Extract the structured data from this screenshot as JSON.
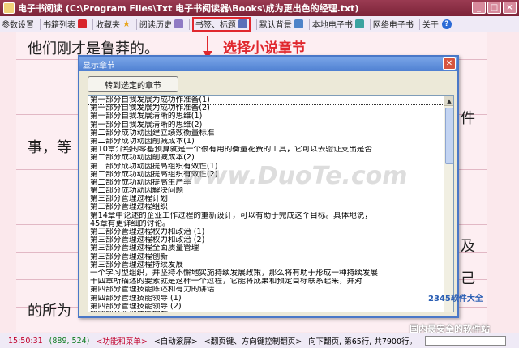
{
  "window": {
    "title": "电子书阅读 (C:\\Program Files\\Txt 电子书阅读器\\Books\\成为更出色的经理.txt)"
  },
  "toolbar": {
    "items": [
      {
        "label": "参数设置",
        "icon": "settings-icon"
      },
      {
        "label": "书籍列表",
        "icon": "book-list-icon"
      },
      {
        "label": "收藏夹",
        "icon": "favorites-star-icon"
      },
      {
        "label": "阅读历史",
        "icon": "history-icon"
      },
      {
        "label": "书签、标题",
        "icon": "bookmark-icon"
      },
      {
        "label": "默认背景",
        "icon": "background-icon"
      },
      {
        "label": "本地电子书",
        "icon": "local-ebook-icon"
      },
      {
        "label": "网络电子书",
        "icon": "network-ebook-icon"
      },
      {
        "label": "关于",
        "icon": "help-icon"
      }
    ],
    "help_glyph": "?"
  },
  "annotation": "选择小说章节",
  "page_text": {
    "line1": "他们刚才是鲁莽的。",
    "line2": "事，等",
    "line3": "的所为",
    "right1": "件",
    "right2": "己",
    "right3": "及"
  },
  "dialog": {
    "title": "显示章节",
    "close_glyph": "✕",
    "goto_button": "转到选定的章节",
    "chapters": [
      "第一部分自我发展为成功作准备(1)",
      "第一部分自我发展为成功作准备(2)",
      "第一部分自我发展清晰的思维(1)",
      "第一部分自我发展清晰的思维(2)",
      "第二部分成功动因建立绩效衡量标准",
      "第二部分成功动因削减成本(1)",
      "第10章介绍的零基预算就是一个很有用的衡量花费的工具，它可以去验证支出是否",
      "第二部分成功动因削减成本(2)",
      "第二部分成功动因提高组织有效性(1)",
      "第二部分成功动因提高组织有效性(2)",
      "第二部分成功动因提高生产率",
      "第二部分成功动因解决问题",
      "第三部分管理过程计划",
      "第三部分管理过程组织",
      "第14章中论述的企业工作过程的重新设计，可以有助于完成这个目标。具体地说，",
      "45章有更详细的讨论。",
      "第三部分管理过程权力和政治 (1)",
      "第三部分管理过程权力和政治 (2)",
      "第三部分管理过程全面质量管理",
      "第三部分管理过程创新",
      "第三部分管理过程持续发展",
      "一个学习型组织，并坚持不懈地实施持续发展政策，那么将有助于形成一种持续发展",
      "十四章所描述的要素就是这样一个过程，它能将成果和预定目标联系起来，并对",
      "第四部分管理技能陈述和有力的讲话",
      "第四部分管理技能领导 (1)",
      "第四部分管理技能领导 (2)",
      "第四部分管理技能控制"
    ]
  },
  "watermark": "www.DuoTe.com",
  "badge": "2345软件大全",
  "badge2": "国内最安全的软件站",
  "status": {
    "time": "15:50:31",
    "coords": "(889, 524)",
    "func": "<功能和菜单>",
    "auto": "<自动滚屏>",
    "keys": "<翻页键、方向键控制翻页>",
    "page": "向下翻页, 第65行, 共7900行。"
  },
  "colors": {
    "accent_red": "#e0282e",
    "title_bar": "#8b2d45",
    "dialog_border": "#4a78c8"
  }
}
